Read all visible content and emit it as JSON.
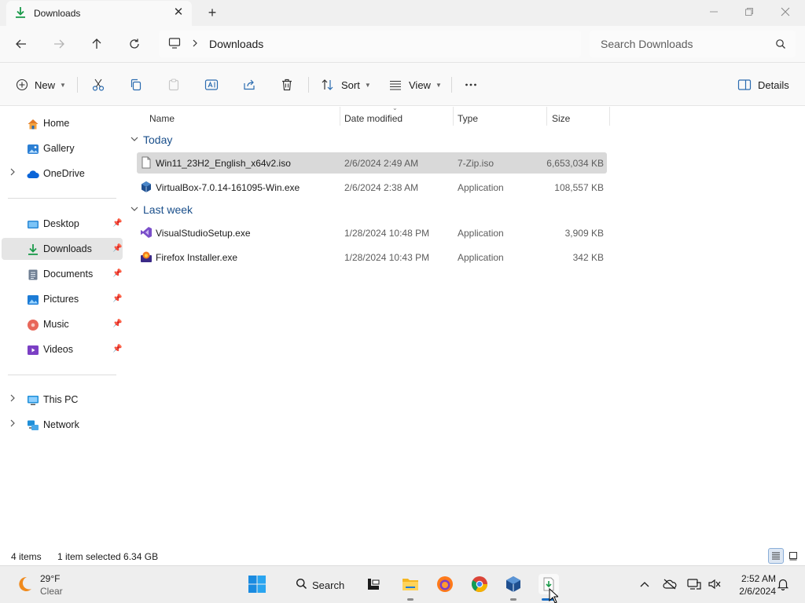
{
  "window": {
    "tab_title": "Downloads",
    "new_tab_symbol": "+"
  },
  "address": {
    "breadcrumb": [
      "Downloads"
    ],
    "search_placeholder": "Search Downloads"
  },
  "commands": {
    "new_label": "New",
    "sort_label": "Sort",
    "view_label": "View",
    "details_label": "Details"
  },
  "sidebar": {
    "quick": [
      {
        "label": "Home",
        "icon": "home-icon"
      },
      {
        "label": "Gallery",
        "icon": "gallery-icon"
      },
      {
        "label": "OneDrive",
        "icon": "onedrive-icon"
      }
    ],
    "pinned": [
      {
        "label": "Desktop",
        "icon": "desktop-icon"
      },
      {
        "label": "Downloads",
        "icon": "downloads-icon"
      },
      {
        "label": "Documents",
        "icon": "documents-icon"
      },
      {
        "label": "Pictures",
        "icon": "pictures-icon"
      },
      {
        "label": "Music",
        "icon": "music-icon"
      },
      {
        "label": "Videos",
        "icon": "videos-icon"
      }
    ],
    "devices": [
      {
        "label": "This PC",
        "icon": "this-pc-icon"
      },
      {
        "label": "Network",
        "icon": "network-icon"
      }
    ]
  },
  "columns": {
    "name": "Name",
    "date": "Date modified",
    "type": "Type",
    "size": "Size"
  },
  "groups": [
    {
      "label": "Today",
      "files": [
        {
          "name": "Win11_23H2_English_x64v2.iso",
          "date": "2/6/2024 2:49 AM",
          "type": "7-Zip.iso",
          "size": "6,653,034 KB",
          "selected": true,
          "icon": "iso-file-icon"
        },
        {
          "name": "VirtualBox-7.0.14-161095-Win.exe",
          "date": "2/6/2024 2:38 AM",
          "type": "Application",
          "size": "108,557 KB",
          "selected": false,
          "icon": "virtualbox-icon"
        }
      ]
    },
    {
      "label": "Last week",
      "files": [
        {
          "name": "VisualStudioSetup.exe",
          "date": "1/28/2024 10:48 PM",
          "type": "Application",
          "size": "3,909 KB",
          "selected": false,
          "icon": "visual-studio-icon"
        },
        {
          "name": "Firefox Installer.exe",
          "date": "1/28/2024 10:43 PM",
          "type": "Application",
          "size": "342 KB",
          "selected": false,
          "icon": "firefox-installer-icon"
        }
      ]
    }
  ],
  "status": {
    "item_count": "4 items",
    "selection": "1 item selected  6.34 GB"
  },
  "taskbar": {
    "weather_temp": "29°F",
    "weather_cond": "Clear",
    "search_label": "Search",
    "time": "2:52 AM",
    "date": "2/6/2024"
  },
  "colors": {
    "accent": "#0067c0",
    "selection": "#d9d9d9",
    "group_header": "#1a4f8b"
  }
}
